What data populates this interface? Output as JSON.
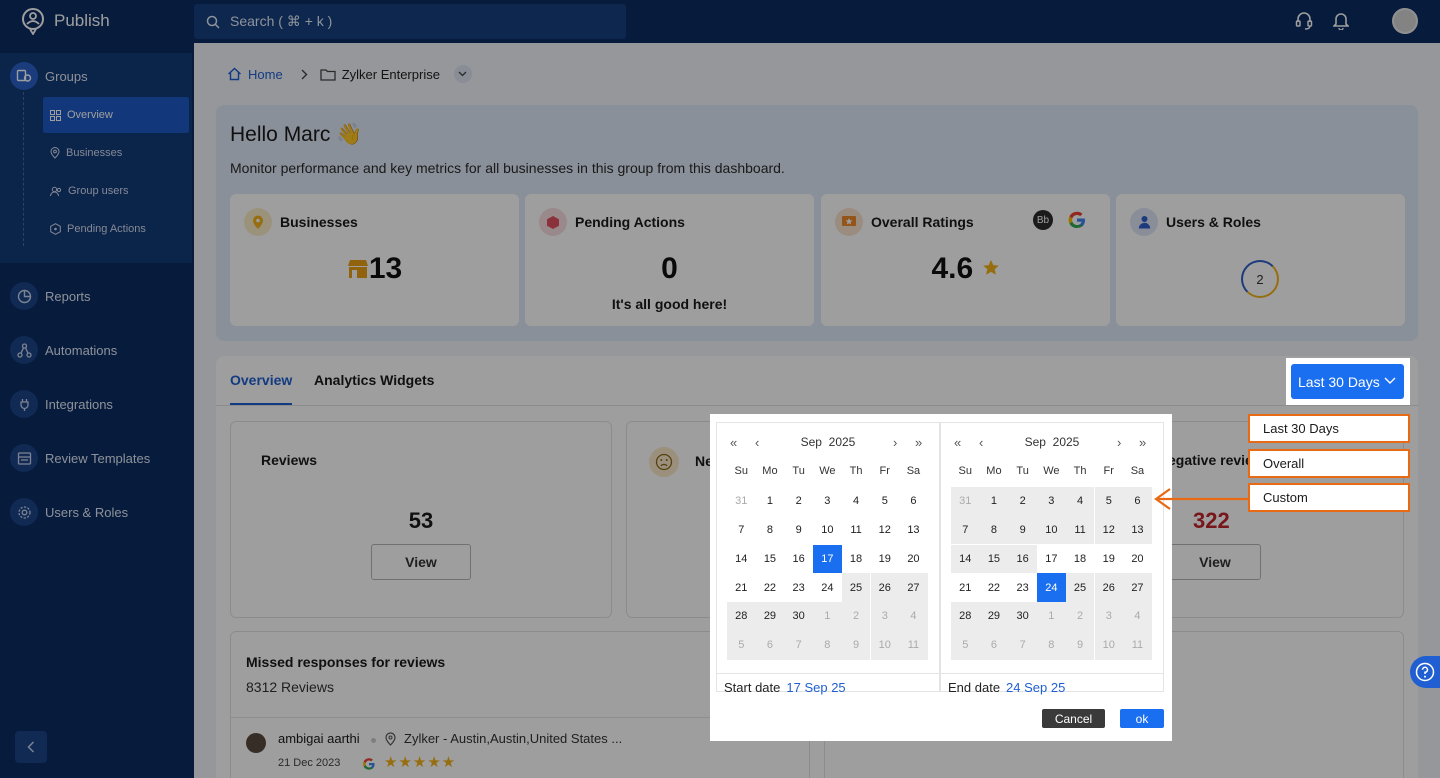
{
  "app": {
    "name": "Publish"
  },
  "search": {
    "placeholder": "Search ( ⌘ + k )"
  },
  "sidebar": {
    "groups_label": "Groups",
    "sub_items": [
      {
        "label": "Overview"
      },
      {
        "label": "Businesses"
      },
      {
        "label": "Group users"
      },
      {
        "label": "Pending Actions"
      }
    ],
    "items": [
      {
        "label": "Reports"
      },
      {
        "label": "Automations"
      },
      {
        "label": "Integrations"
      },
      {
        "label": "Review Templates"
      },
      {
        "label": "Users & Roles"
      }
    ]
  },
  "breadcrumb": {
    "home": "Home",
    "current": "Zylker Enterprise"
  },
  "greeting": {
    "title": "Hello Marc 👋",
    "subtitle": "Monitor performance and key metrics for all businesses in this group from this dashboard."
  },
  "stats": [
    {
      "title": "Businesses",
      "value": "13",
      "sub": ""
    },
    {
      "title": "Pending Actions",
      "value": "0",
      "sub": "It's all good here!"
    },
    {
      "title": "Overall Ratings",
      "value": "4.6",
      "sub": "",
      "badge": "Bb"
    },
    {
      "title": "Users & Roles",
      "value": "2",
      "sub": ""
    }
  ],
  "tabs": [
    {
      "label": "Overview"
    },
    {
      "label": "Analytics Widgets"
    }
  ],
  "date_filter": {
    "selected": "Last 30 Days"
  },
  "cards": {
    "reviews": {
      "title": "Reviews",
      "value": "53",
      "button": "View"
    },
    "neutral": {
      "title": "Ne"
    },
    "negative": {
      "title": "egative revie",
      "value": "322",
      "button": "View"
    },
    "missed": {
      "title": "Missed responses for reviews",
      "count": "8312 Reviews"
    }
  },
  "review_entry": {
    "author": "ambigai aarthi",
    "location": "Zylker - Austin,Austin,United States ...",
    "date": "21 Dec 2023",
    "stars": "★★★★★"
  },
  "calendar": {
    "left": {
      "month": "Sep",
      "year": "2025",
      "weekdays": [
        "Su",
        "Mo",
        "Tu",
        "We",
        "Th",
        "Fr",
        "Sa"
      ],
      "days": [
        "31",
        "1",
        "2",
        "3",
        "4",
        "5",
        "6",
        "7",
        "8",
        "9",
        "10",
        "11",
        "12",
        "13",
        "14",
        "15",
        "16",
        "17",
        "18",
        "19",
        "20",
        "21",
        "22",
        "23",
        "24",
        "25",
        "26",
        "27",
        "28",
        "29",
        "30",
        "1",
        "2",
        "3",
        "4",
        "5",
        "6",
        "7",
        "8",
        "9",
        "10",
        "11"
      ],
      "footer_label": "Start date",
      "footer_value": "17 Sep 25"
    },
    "right": {
      "month": "Sep",
      "year": "2025",
      "weekdays": [
        "Su",
        "Mo",
        "Tu",
        "We",
        "Th",
        "Fr",
        "Sa"
      ],
      "days": [
        "31",
        "1",
        "2",
        "3",
        "4",
        "5",
        "6",
        "7",
        "8",
        "9",
        "10",
        "11",
        "12",
        "13",
        "14",
        "15",
        "16",
        "17",
        "18",
        "19",
        "20",
        "21",
        "22",
        "23",
        "24",
        "25",
        "26",
        "27",
        "28",
        "29",
        "30",
        "1",
        "2",
        "3",
        "4",
        "5",
        "6",
        "7",
        "8",
        "9",
        "10",
        "11"
      ],
      "footer_label": "End date",
      "footer_value": "24 Sep 25"
    },
    "cancel": "Cancel",
    "ok": "ok"
  },
  "date_options": [
    {
      "label": "Last 30 Days"
    },
    {
      "label": "Overall"
    },
    {
      "label": "Custom"
    }
  ],
  "colors": {
    "brand_navy": "#0c2d63",
    "accent_blue": "#1a6ef0",
    "callout_orange": "#e86a14",
    "negative_red": "#c0262c"
  }
}
